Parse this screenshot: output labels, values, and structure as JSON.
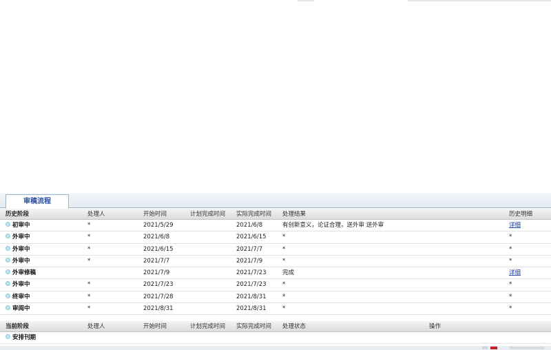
{
  "tabs": [
    {
      "label": "审稿流程",
      "active": true
    }
  ],
  "history": {
    "columns": [
      "历史阶段",
      "处理人",
      "开始时间",
      "计划完成时间",
      "实际完成时间",
      "处理结果",
      "历史明细"
    ],
    "rows": [
      {
        "stage": "初审中",
        "handler": "*",
        "start": "2021/5/29",
        "planned": "",
        "actual": "2021/6/8",
        "result": "有创新意义，论证合理，送外审 送外审",
        "detail": "详细",
        "detail_link": true
      },
      {
        "stage": "外审中",
        "handler": "*",
        "start": "2021/6/8",
        "planned": "",
        "actual": "2021/6/15",
        "result": "*",
        "detail": "*",
        "detail_link": false
      },
      {
        "stage": "外审中",
        "handler": "*",
        "start": "2021/6/15",
        "planned": "",
        "actual": "2021/7/7",
        "result": "*",
        "detail": "*",
        "detail_link": false
      },
      {
        "stage": "外审中",
        "handler": "*",
        "start": "2021/7/7",
        "planned": "",
        "actual": "2021/7/9",
        "result": "*",
        "detail": "*",
        "detail_link": false
      },
      {
        "stage": "外审修稿",
        "handler": "",
        "start": "2021/7/9",
        "planned": "",
        "actual": "2021/7/23",
        "result": "完成",
        "detail": "详细",
        "detail_link": true
      },
      {
        "stage": "外审中",
        "handler": "*",
        "start": "2021/7/23",
        "planned": "",
        "actual": "2021/7/23",
        "result": "*",
        "detail": "*",
        "detail_link": false
      },
      {
        "stage": "终审中",
        "handler": "*",
        "start": "2021/7/28",
        "planned": "",
        "actual": "2021/8/31",
        "result": "*",
        "detail": "*",
        "detail_link": false
      },
      {
        "stage": "审阅中",
        "handler": "*",
        "start": "2021/8/31",
        "planned": "",
        "actual": "2021/8/31",
        "result": "*",
        "detail": "*",
        "detail_link": false
      }
    ]
  },
  "current": {
    "columns": [
      "当前阶段",
      "处理人",
      "开始时间",
      "计划完成时间",
      "实际完成时间",
      "处理状态",
      "操作"
    ],
    "rows": [
      {
        "stage": "安排刊期",
        "handler": "",
        "start": "",
        "planned": "",
        "actual": "",
        "status": "",
        "action": ""
      }
    ]
  }
}
